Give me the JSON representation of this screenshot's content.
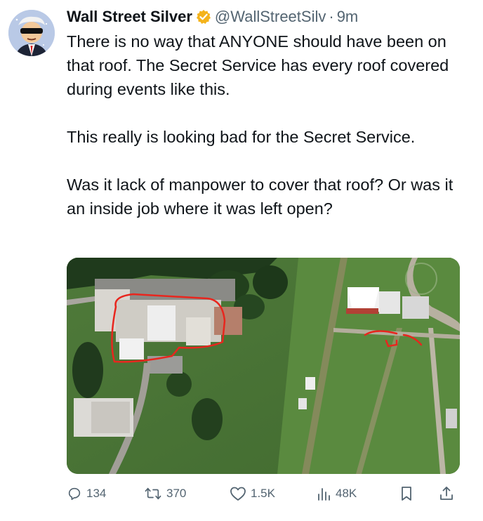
{
  "tweet": {
    "author": {
      "display_name": "Wall Street Silver",
      "handle": "@WallStreetSilv",
      "verified_badge_icon": "verified-badge-icon",
      "avatar_icon": "avatar-cartoon"
    },
    "separator": "·",
    "time": "9m",
    "paragraphs": [
      "There is no way that ANYONE should have been on that roof. The Secret Service has every roof covered during events like this.",
      "This really is looking bad for the Secret Service.",
      "Was it lack of manpower to cover that roof? Or was it an inside job where it was left open?"
    ],
    "media": {
      "type": "aerial-photo",
      "icon": "aerial-photo-image"
    },
    "actions": {
      "reply": {
        "icon": "reply-icon",
        "count": "134"
      },
      "retweet": {
        "icon": "retweet-icon",
        "count": "370"
      },
      "like": {
        "icon": "heart-icon",
        "count": "1.5K"
      },
      "views": {
        "icon": "views-icon",
        "count": "48K"
      },
      "bookmark": {
        "icon": "bookmark-icon"
      },
      "share": {
        "icon": "share-icon"
      }
    },
    "colors": {
      "text": "#0f1419",
      "secondary": "#536471",
      "verified": "#f4b31b"
    }
  }
}
